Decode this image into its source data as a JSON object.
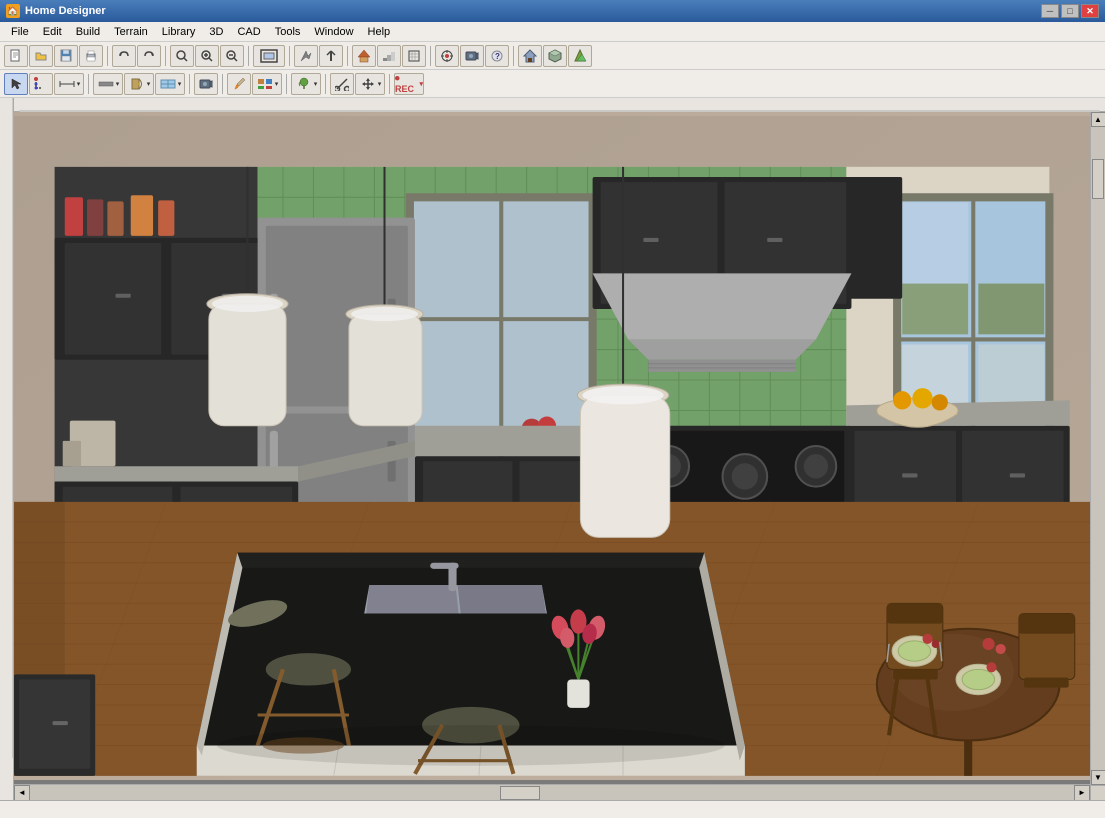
{
  "titleBar": {
    "title": "Home Designer",
    "icon": "🏠",
    "controls": {
      "minimize": "─",
      "maximize": "□",
      "close": "✕"
    }
  },
  "menuBar": {
    "items": [
      "File",
      "Edit",
      "Build",
      "Terrain",
      "Library",
      "3D",
      "CAD",
      "Tools",
      "Window",
      "Help"
    ]
  },
  "toolbar1": {
    "buttons": [
      {
        "name": "new",
        "icon": "📄"
      },
      {
        "name": "open",
        "icon": "📂"
      },
      {
        "name": "save",
        "icon": "💾"
      },
      {
        "name": "print",
        "icon": "🖨"
      },
      {
        "sep": true
      },
      {
        "name": "undo",
        "icon": "↩"
      },
      {
        "name": "redo",
        "icon": "↪"
      },
      {
        "sep": true
      },
      {
        "name": "zoom-out-small",
        "icon": "🔍"
      },
      {
        "name": "zoom-in",
        "icon": "⊕"
      },
      {
        "name": "zoom-out",
        "icon": "⊖"
      },
      {
        "sep": true
      },
      {
        "name": "fit-page",
        "icon": "⊞"
      },
      {
        "sep": true
      },
      {
        "name": "arrow-tool",
        "icon": "↖"
      },
      {
        "name": "move",
        "icon": "✛"
      },
      {
        "sep": true
      },
      {
        "name": "measure",
        "icon": "📐"
      },
      {
        "name": "camera",
        "icon": "📷"
      },
      {
        "name": "help",
        "icon": "?"
      },
      {
        "sep": true
      },
      {
        "name": "house",
        "icon": "🏠"
      },
      {
        "name": "building",
        "icon": "🏗"
      },
      {
        "name": "tree",
        "icon": "🌳"
      }
    ]
  },
  "toolbar2": {
    "buttons": [
      {
        "name": "select",
        "icon": "↖",
        "active": true
      },
      {
        "name": "polygon",
        "icon": "⬡"
      },
      {
        "name": "dimension",
        "icon": "↔"
      },
      {
        "name": "wall",
        "icon": "▭"
      },
      {
        "name": "door",
        "icon": "🚪"
      },
      {
        "name": "window-tool",
        "icon": "⊟"
      },
      {
        "name": "camera2",
        "icon": "📷"
      },
      {
        "name": "paint",
        "icon": "🎨"
      },
      {
        "name": "material",
        "icon": "⬜"
      },
      {
        "name": "plant",
        "icon": "🌿"
      },
      {
        "name": "trim",
        "icon": "✂"
      },
      {
        "name": "move2",
        "icon": "⊕"
      },
      {
        "name": "record",
        "icon": "⏺"
      }
    ]
  },
  "canvas": {
    "scene": "3D Kitchen View"
  },
  "statusBar": {
    "text": ""
  }
}
